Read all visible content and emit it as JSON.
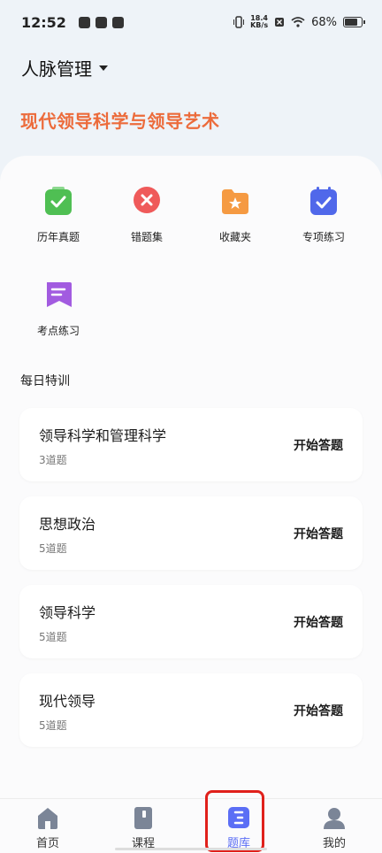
{
  "status_bar": {
    "time": "12:52",
    "net_speed_top": "18.4",
    "net_speed_bottom": "KB/s",
    "battery": "68%"
  },
  "header": {
    "title": "人脉管理"
  },
  "subject": "现代领导科学与领导艺术",
  "tools": [
    {
      "label": "历年真题",
      "icon": "clipboard-check-icon",
      "color": "#4fbf53"
    },
    {
      "label": "错题集",
      "icon": "wrong-x-icon",
      "color": "#ef5a5a"
    },
    {
      "label": "收藏夹",
      "icon": "folder-star-icon",
      "color": "#f59a42"
    },
    {
      "label": "专项练习",
      "icon": "calendar-check-icon",
      "color": "#5068ea"
    },
    {
      "label": "考点练习",
      "icon": "bookmark-doc-icon",
      "color": "#a25be0"
    }
  ],
  "daily": {
    "title": "每日特训",
    "items": [
      {
        "name": "领导科学和管理科学",
        "count": "3道题",
        "action": "开始答题"
      },
      {
        "name": "思想政治",
        "count": "5道题",
        "action": "开始答题"
      },
      {
        "name": "领导科学",
        "count": "5道题",
        "action": "开始答题"
      },
      {
        "name": "现代领导",
        "count": "5道题",
        "action": "开始答题"
      }
    ]
  },
  "tabbar": {
    "tabs": [
      {
        "label": "首页",
        "icon": "home-icon"
      },
      {
        "label": "课程",
        "icon": "book-icon"
      },
      {
        "label": "题库",
        "icon": "question-bank-icon",
        "active": true
      },
      {
        "label": "我的",
        "icon": "profile-icon"
      }
    ],
    "active_color": "#5b6ef5"
  }
}
